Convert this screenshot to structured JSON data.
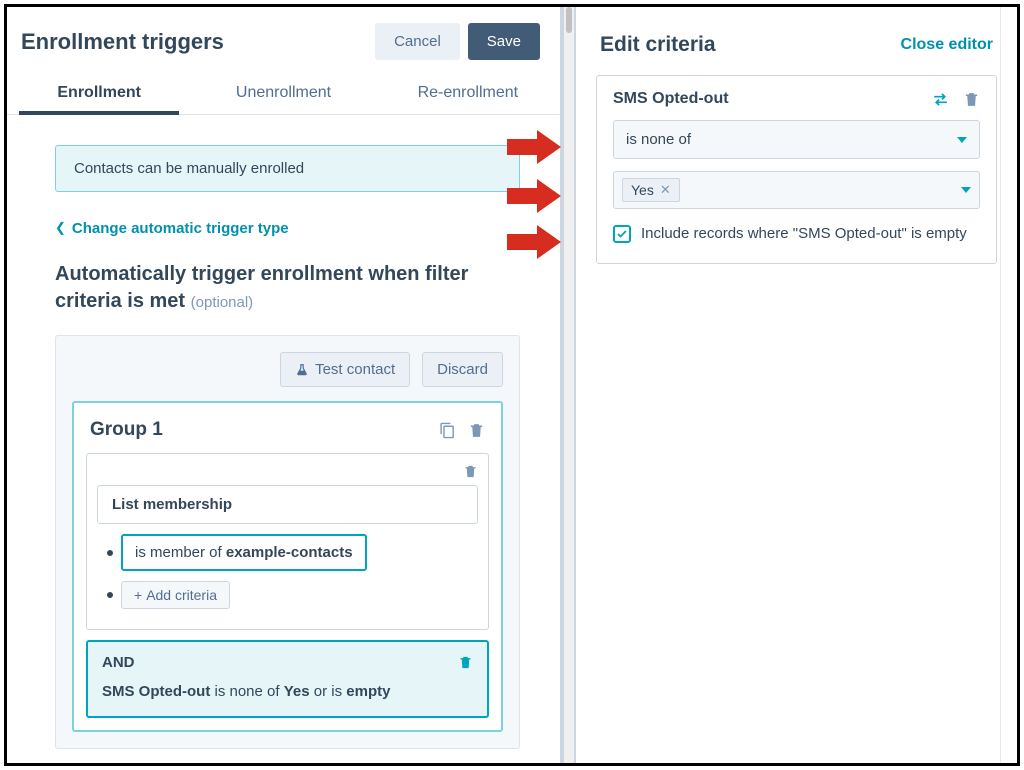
{
  "left": {
    "title": "Enrollment triggers",
    "buttons": {
      "cancel": "Cancel",
      "save": "Save"
    },
    "tabs": [
      "Enrollment",
      "Unenrollment",
      "Re-enrollment"
    ],
    "manualNotice": "Contacts can be manually enrolled",
    "changeType": "Change automatic trigger type",
    "filterHeading": "Automatically trigger enrollment when filter criteria is met",
    "optional": "(optional)",
    "testContact": "Test contact",
    "discard": "Discard",
    "group": {
      "title": "Group 1",
      "listMembershipLabel": "List membership",
      "memberPrefix": "is member of ",
      "memberList": "example-contacts",
      "addCriteria": "Add criteria",
      "andLabel": "AND",
      "andTextParts": {
        "prop": "SMS Opted-out",
        "mid": " is none of ",
        "val": "Yes",
        "orIs": " or is ",
        "empty": "empty"
      }
    }
  },
  "right": {
    "title": "Edit criteria",
    "close": "Close editor",
    "property": "SMS Opted-out",
    "operator": "is none of",
    "tagValue": "Yes",
    "includeEmpty": "Include records where \"SMS Opted-out\" is empty"
  }
}
